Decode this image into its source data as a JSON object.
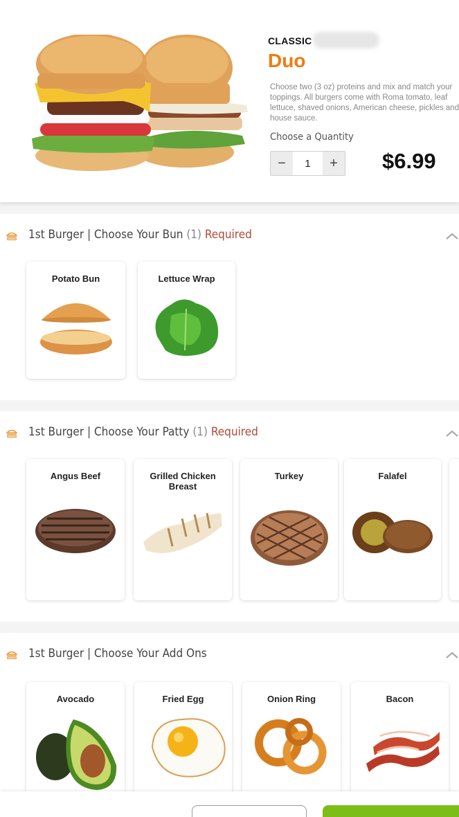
{
  "product": {
    "brand": "CLASSIC",
    "title": "Duo",
    "description": "Choose two (3 oz) proteins and mix and match your toppings. All burgers come with Roma tomato, leaf lettuce, shaved onions, American cheese, pickles and house sauce.",
    "quantity_label": "Choose a Quantity",
    "quantity": "1",
    "minus": "−",
    "plus": "+",
    "price": "$6.99"
  },
  "sections": [
    {
      "title": "1st Burger | Choose Your Bun",
      "count": "(1)",
      "required": "Required",
      "options": [
        {
          "label": "Potato Bun",
          "icon": "potato-bun-image"
        },
        {
          "label": "Lettuce Wrap",
          "icon": "lettuce-wrap-image"
        }
      ]
    },
    {
      "title": "1st Burger | Choose Your Patty",
      "count": "(1)",
      "required": "Required",
      "options": [
        {
          "label": "Angus Beef",
          "icon": "angus-beef-image"
        },
        {
          "label": "Grilled Chicken Breast",
          "icon": "grilled-chicken-image"
        },
        {
          "label": "Turkey",
          "icon": "turkey-patty-image"
        },
        {
          "label": "Falafel",
          "icon": "falafel-image"
        }
      ]
    },
    {
      "title": "1st Burger | Choose Your Add Ons",
      "options": [
        {
          "label": "Avocado",
          "icon": "avocado-image"
        },
        {
          "label": "Fried Egg",
          "icon": "fried-egg-image"
        },
        {
          "label": "Onion Ring",
          "icon": "onion-ring-image"
        },
        {
          "label": "Bacon",
          "icon": "bacon-image"
        }
      ]
    }
  ],
  "colors": {
    "accent_orange": "#f07a10",
    "required_red": "#b24a38",
    "primary_green": "#7cbd18"
  }
}
